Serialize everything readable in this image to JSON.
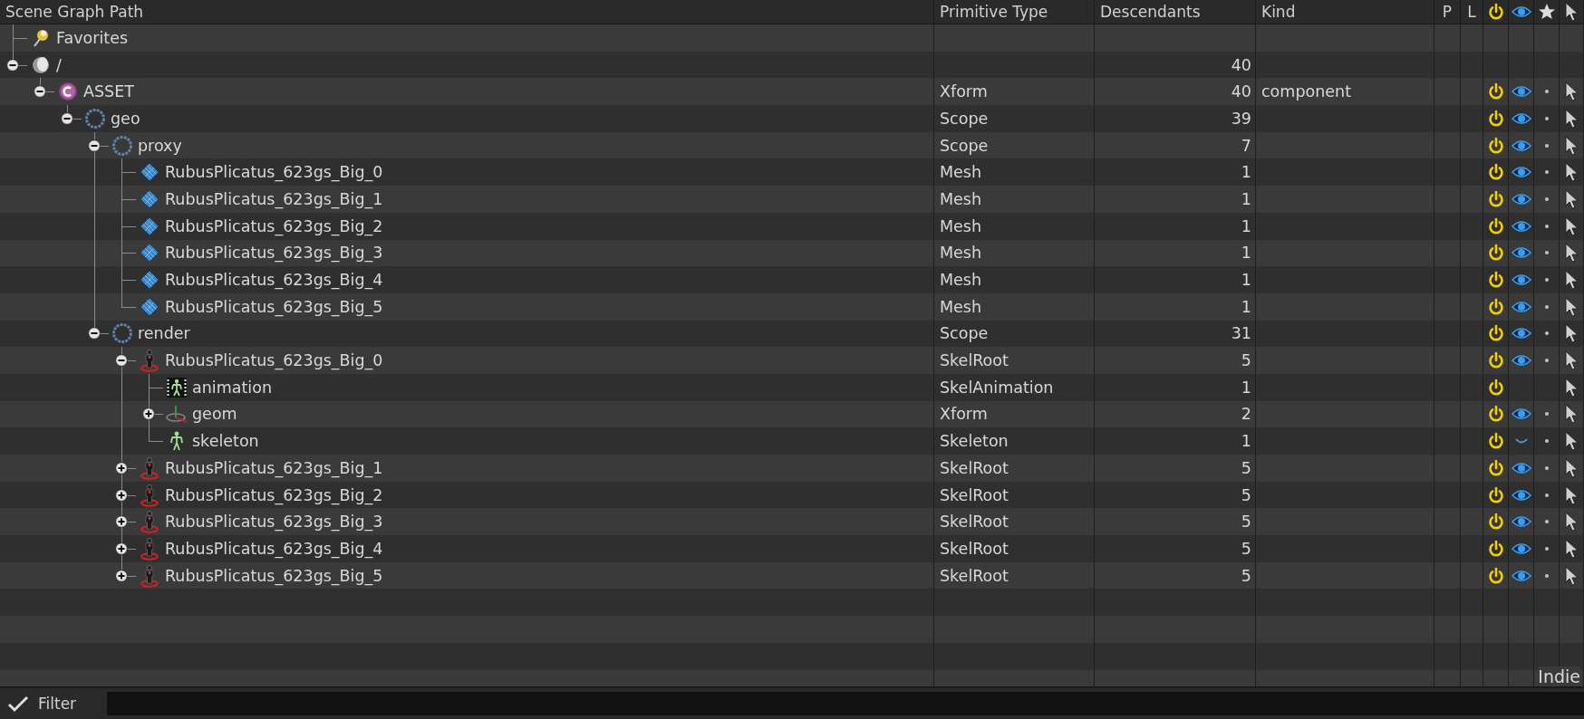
{
  "columns": [
    "Scene Graph Path",
    "Primitive Type",
    "Descendants",
    "Kind",
    "P",
    "L"
  ],
  "tree": [
    {
      "label": "Favorites",
      "kind": "favorites"
    },
    {
      "label": "/",
      "kind": "root",
      "descendants": "40",
      "expanded": true,
      "children": [
        {
          "label": "ASSET",
          "kind": "component",
          "type": "Xform",
          "descendants": "40",
          "prim_kind": "component",
          "expanded": true,
          "active": true,
          "visible": true,
          "dot": true,
          "selectable": true,
          "children": [
            {
              "label": "geo",
              "kind": "scope",
              "type": "Scope",
              "descendants": "39",
              "expanded": true,
              "active": true,
              "visible": true,
              "dot": true,
              "selectable": true,
              "children": [
                {
                  "label": "proxy",
                  "kind": "scope",
                  "type": "Scope",
                  "descendants": "7",
                  "expanded": true,
                  "active": true,
                  "visible": true,
                  "dot": true,
                  "selectable": true,
                  "children": [
                    {
                      "label": "RubusPlicatus_623gs_Big_0",
                      "kind": "mesh",
                      "type": "Mesh",
                      "descendants": "1",
                      "active": true,
                      "visible": true,
                      "dot": true,
                      "selectable": true
                    },
                    {
                      "label": "RubusPlicatus_623gs_Big_1",
                      "kind": "mesh",
                      "type": "Mesh",
                      "descendants": "1",
                      "active": true,
                      "visible": true,
                      "dot": true,
                      "selectable": true
                    },
                    {
                      "label": "RubusPlicatus_623gs_Big_2",
                      "kind": "mesh",
                      "type": "Mesh",
                      "descendants": "1",
                      "active": true,
                      "visible": true,
                      "dot": true,
                      "selectable": true
                    },
                    {
                      "label": "RubusPlicatus_623gs_Big_3",
                      "kind": "mesh",
                      "type": "Mesh",
                      "descendants": "1",
                      "active": true,
                      "visible": true,
                      "dot": true,
                      "selectable": true
                    },
                    {
                      "label": "RubusPlicatus_623gs_Big_4",
                      "kind": "mesh",
                      "type": "Mesh",
                      "descendants": "1",
                      "active": true,
                      "visible": true,
                      "dot": true,
                      "selectable": true
                    },
                    {
                      "label": "RubusPlicatus_623gs_Big_5",
                      "kind": "mesh",
                      "type": "Mesh",
                      "descendants": "1",
                      "active": true,
                      "visible": true,
                      "dot": true,
                      "selectable": true
                    }
                  ]
                },
                {
                  "label": "render",
                  "kind": "scope",
                  "type": "Scope",
                  "descendants": "31",
                  "expanded": true,
                  "active": true,
                  "visible": true,
                  "dot": true,
                  "selectable": true,
                  "children": [
                    {
                      "label": "RubusPlicatus_623gs_Big_0",
                      "kind": "skelroot",
                      "type": "SkelRoot",
                      "descendants": "5",
                      "expanded": true,
                      "active": true,
                      "visible": true,
                      "dot": true,
                      "selectable": true,
                      "children": [
                        {
                          "label": "animation",
                          "kind": "skelanim",
                          "type": "SkelAnimation",
                          "descendants": "1",
                          "active": true,
                          "selectable": true
                        },
                        {
                          "label": "geom",
                          "kind": "xform",
                          "type": "Xform",
                          "descendants": "2",
                          "expanded": false,
                          "active": true,
                          "visible": true,
                          "dot": true,
                          "selectable": true
                        },
                        {
                          "label": "skeleton",
                          "kind": "skeleton",
                          "type": "Skeleton",
                          "descendants": "1",
                          "active": true,
                          "visible": false,
                          "dot": true,
                          "selectable": true
                        }
                      ]
                    },
                    {
                      "label": "RubusPlicatus_623gs_Big_1",
                      "kind": "skelroot",
                      "type": "SkelRoot",
                      "descendants": "5",
                      "expanded": false,
                      "active": true,
                      "visible": true,
                      "dot": true,
                      "selectable": true
                    },
                    {
                      "label": "RubusPlicatus_623gs_Big_2",
                      "kind": "skelroot",
                      "type": "SkelRoot",
                      "descendants": "5",
                      "expanded": false,
                      "active": true,
                      "visible": true,
                      "dot": true,
                      "selectable": true
                    },
                    {
                      "label": "RubusPlicatus_623gs_Big_3",
                      "kind": "skelroot",
                      "type": "SkelRoot",
                      "descendants": "5",
                      "expanded": false,
                      "active": true,
                      "visible": true,
                      "dot": true,
                      "selectable": true
                    },
                    {
                      "label": "RubusPlicatus_623gs_Big_4",
                      "kind": "skelroot",
                      "type": "SkelRoot",
                      "descendants": "5",
                      "expanded": false,
                      "active": true,
                      "visible": true,
                      "dot": true,
                      "selectable": true
                    },
                    {
                      "label": "RubusPlicatus_623gs_Big_5",
                      "kind": "skelroot",
                      "type": "SkelRoot",
                      "descendants": "5",
                      "expanded": false,
                      "active": true,
                      "visible": true,
                      "dot": true,
                      "selectable": true
                    }
                  ]
                }
              ]
            }
          ]
        }
      ]
    }
  ],
  "license_badge": "Indie",
  "filter": {
    "label": "Filter"
  }
}
